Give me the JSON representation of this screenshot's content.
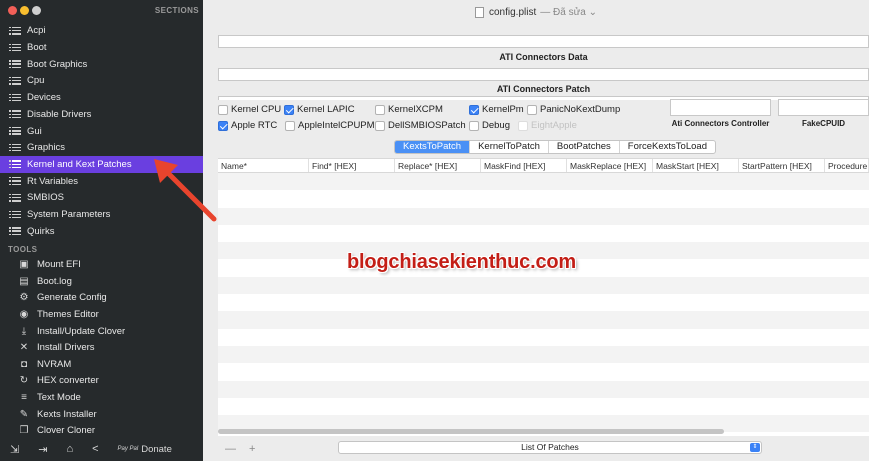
{
  "window": {
    "title": "config.plist",
    "edited": "— Đã sửa ⌄"
  },
  "sidebar": {
    "sections_label": "SECTIONS",
    "sections": [
      {
        "label": "Acpi"
      },
      {
        "label": "Boot"
      },
      {
        "label": "Boot Graphics"
      },
      {
        "label": "Cpu"
      },
      {
        "label": "Devices"
      },
      {
        "label": "Disable Drivers"
      },
      {
        "label": "Gui"
      },
      {
        "label": "Graphics"
      },
      {
        "label": "Kernel and Kext Patches",
        "active": true
      },
      {
        "label": "Rt Variables"
      },
      {
        "label": "SMBIOS"
      },
      {
        "label": "System Parameters"
      },
      {
        "label": "Quirks"
      }
    ],
    "tools_label": "TOOLS",
    "tools": [
      {
        "label": "Mount EFI",
        "icon": "disk-icon"
      },
      {
        "label": "Boot.log",
        "icon": "document-icon"
      },
      {
        "label": "Generate Config",
        "icon": "gears-icon"
      },
      {
        "label": "Themes Editor",
        "icon": "palette-icon"
      },
      {
        "label": "Install/Update Clover",
        "icon": "download-icon"
      },
      {
        "label": "Install Drivers",
        "icon": "tools-icon"
      },
      {
        "label": "NVRAM",
        "icon": "chip-icon"
      },
      {
        "label": "HEX converter",
        "icon": "refresh-icon"
      },
      {
        "label": "Text Mode",
        "icon": "text-lines-icon"
      },
      {
        "label": "Kexts Installer",
        "icon": "wrench-icon"
      },
      {
        "label": "Clover Cloner",
        "icon": "copy-icon"
      }
    ],
    "bottom": {
      "donate": "Donate",
      "pay": "Pay Pal"
    }
  },
  "main": {
    "connectors_data_title": "ATI Connectors Data",
    "connectors_patch_title": "ATI Connectors Patch",
    "checkboxes": [
      {
        "label": "Kernel CPU",
        "checked": false
      },
      {
        "label": "Kernel LAPIC",
        "checked": true
      },
      {
        "label": "KernelXCPM",
        "checked": false
      },
      {
        "label": "KernelPm",
        "checked": true
      },
      {
        "label": "PanicNoKextDump",
        "checked": false
      },
      {
        "label": "Apple RTC",
        "checked": true
      },
      {
        "label": "AppleIntelCPUPM",
        "checked": false
      },
      {
        "label": "DellSMBIOSPatch",
        "checked": false
      },
      {
        "label": "Debug",
        "checked": false
      },
      {
        "label": "EightApple",
        "checked": false,
        "disabled": true
      }
    ],
    "controller_label": "Ati Connectors Controller",
    "fakecpuid_label": "FakeCPUID",
    "tabs": [
      "KextsToPatch",
      "KernelToPatch",
      "BootPatches",
      "ForceKextsToLoad"
    ],
    "selected_tab": "KextsToPatch",
    "columns": [
      "Name*",
      "Find* [HEX]",
      "Replace* [HEX]",
      "MaskFind [HEX]",
      "MaskReplace [HEX]",
      "MaskStart [HEX]",
      "StartPattern [HEX]",
      "Procedure"
    ],
    "watermark": "blogchiasekienthuc.com",
    "footer": {
      "add": "+",
      "remove": "—",
      "select_value": "List Of Patches"
    }
  },
  "colors": {
    "accent": "#6a3fe0",
    "tab_selected": "#4a90f5",
    "checkbox_on": "#3b82f6",
    "watermark": "#c31e16",
    "arrow": "#e8442d"
  }
}
